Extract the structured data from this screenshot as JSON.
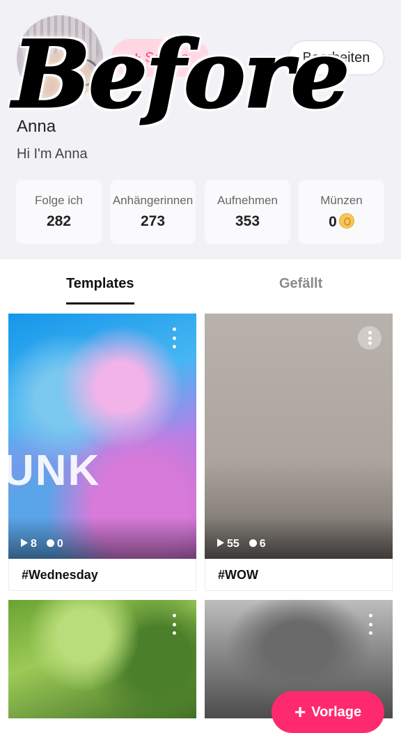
{
  "profile": {
    "name": "Anna",
    "bio": "Hi I'm Anna",
    "follow_label": "So...es",
    "edit_label": "Bearbeiten"
  },
  "stats": [
    {
      "label": "Folge ich",
      "value": "282"
    },
    {
      "label": "Anhängerinnen",
      "value": "273"
    },
    {
      "label": "Aufnehmen",
      "value": "353"
    },
    {
      "label": "Münzen",
      "value": "0"
    }
  ],
  "tabs": [
    {
      "label": "Templates",
      "active": true
    },
    {
      "label": "Gefällt",
      "active": false
    }
  ],
  "cards": [
    {
      "title": "#Wednesday",
      "plays": "8",
      "comments": "0",
      "overlay_text": "UNK"
    },
    {
      "title": "#WOW",
      "plays": "55",
      "comments": "6"
    },
    {
      "title": ""
    },
    {
      "title": ""
    }
  ],
  "fab": {
    "label": "Vorlage"
  },
  "watermark": "Before",
  "colors": {
    "accent": "#ff2a6d",
    "header_bg": "#f1f1f6"
  }
}
